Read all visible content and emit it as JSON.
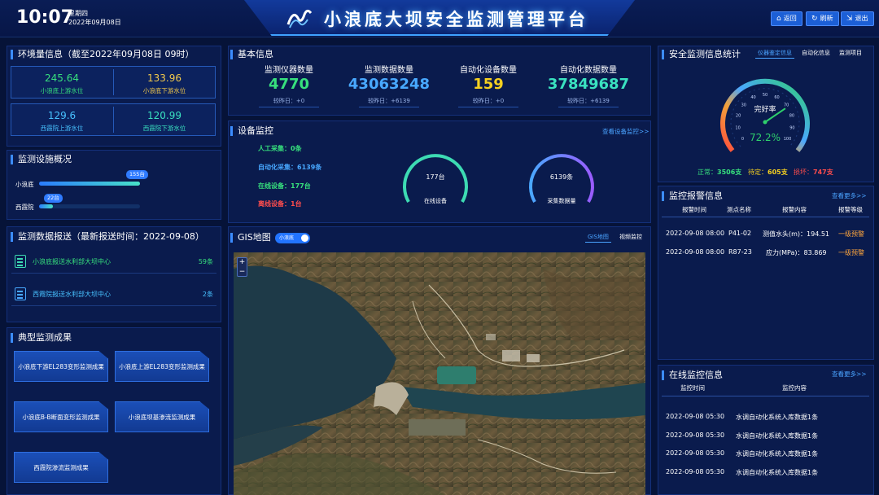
{
  "header": {
    "time": "10:07",
    "weekday": "星期四",
    "date": "2022年09月08日",
    "title": "小浪底大坝安全监测管理平台",
    "buttons": [
      {
        "label": "返回",
        "icon": "home-icon"
      },
      {
        "label": "刷新",
        "icon": "refresh-icon"
      },
      {
        "label": "退出",
        "icon": "exit-icon"
      }
    ]
  },
  "environment": {
    "title": "环境量信息（截至2022年09月08日 09时）",
    "cells": [
      {
        "value": "245.64",
        "label": "小浪底上游水位"
      },
      {
        "value": "133.96",
        "label": "小浪底下游水位"
      },
      {
        "value": "129.6",
        "label": "西霞院上游水位"
      },
      {
        "value": "120.99",
        "label": "西霞院下游水位"
      }
    ]
  },
  "facilities": {
    "title": "监测设施概况",
    "items": [
      {
        "label": "小浪底",
        "count": "155台",
        "fraction": 1.0
      },
      {
        "label": "西霞院",
        "count": "22台",
        "fraction": 0.14
      }
    ]
  },
  "reports": {
    "title": "监测数据报送（最新报送时间：2022-09-08）",
    "items": [
      {
        "label": "小浪底报送水利部大坝中心",
        "count": "59条",
        "color": "#37e07d"
      },
      {
        "label": "西霞院报送水利部大坝中心",
        "count": "2条",
        "color": "#48a8ff"
      }
    ]
  },
  "results": {
    "title": "典型监测成果",
    "items": [
      "小浪底下游EL283变形监测成果",
      "小浪底上游EL283变形监测成果",
      "小浪底B-B断面变形监测成果",
      "小浪底坝基渗流监测成果",
      "西霞院渗流监测成果"
    ]
  },
  "basic": {
    "title": "基本信息",
    "stats": [
      {
        "head": "监测仪器数量",
        "value": "4770",
        "sub": "较昨日：+0",
        "color": "#37e07d"
      },
      {
        "head": "监测数据数量",
        "value": "43063248",
        "sub": "较昨日：+6139",
        "color": "#48a8ff"
      },
      {
        "head": "自动化设备数量",
        "value": "159",
        "sub": "较昨日：+0",
        "color": "#f5d020"
      },
      {
        "head": "自动化数据数量",
        "value": "37849687",
        "sub": "较昨日：+6139",
        "color": "#3ae2c0"
      }
    ]
  },
  "devices": {
    "title": "设备监控",
    "link": "查看设备监控>>",
    "items": [
      {
        "label": "人工采集：0条",
        "color": "#37e07d"
      },
      {
        "label": "自动化采集：6139条",
        "color": "#48a8ff"
      },
      {
        "label": "在线设备：177台",
        "color": "#37e07d"
      },
      {
        "label": "离线设备：1台",
        "color": "#ff4d4d"
      }
    ],
    "rings": [
      {
        "value": "177台",
        "label": "在线设备",
        "color": "#3ddbb2"
      },
      {
        "value": "6139条",
        "label": "采集数据量",
        "color": "#7b6cff"
      }
    ]
  },
  "gis": {
    "title": "GIS地图",
    "toggle_label": "小浪底",
    "tabs": [
      "GIS地图",
      "视频监控"
    ],
    "zoom_in": "+",
    "zoom_out": "−"
  },
  "safety": {
    "title": "安全监测信息统计",
    "tabs": [
      "仪器鉴定信息",
      "自动化信息",
      "监测项目"
    ],
    "gauge_label": "完好率",
    "gauge_value": "72.2%",
    "gauge_fraction": 0.722,
    "ticks": [
      "0",
      "10",
      "20",
      "30",
      "40",
      "50",
      "60",
      "70",
      "80",
      "90",
      "100"
    ],
    "summary": [
      {
        "label": "正常：",
        "value": "3506支",
        "color": "#37e07d"
      },
      {
        "label": "待定：",
        "value": "605支",
        "color": "#f5d020"
      },
      {
        "label": "损坏：",
        "value": "747支",
        "color": "#ff4d4d"
      }
    ]
  },
  "alarms": {
    "title": "监控报警信息",
    "link": "查看更多>>",
    "headers": [
      "报警时间",
      "测点名称",
      "报警内容",
      "报警等级"
    ],
    "rows": [
      [
        "2022-09-08 08:00",
        "P41-02",
        "测值水头(m)：194.51",
        "一级预警"
      ],
      [
        "2022-09-08 08:00",
        "R87-23",
        "应力(MPa)：83.869",
        "一级预警"
      ]
    ]
  },
  "online": {
    "title": "在线监控信息",
    "link": "查看更多>>",
    "headers": [
      "监控时间",
      "监控内容"
    ],
    "rows": [
      [
        "2022-09-08 05:30",
        "水调自动化系统入库数据1条"
      ],
      [
        "2022-09-08 05:30",
        "水调自动化系统入库数据1条"
      ],
      [
        "2022-09-08 05:30",
        "水调自动化系统入库数据1条"
      ],
      [
        "2022-09-08 05:30",
        "水调自动化系统入库数据1条"
      ]
    ]
  }
}
